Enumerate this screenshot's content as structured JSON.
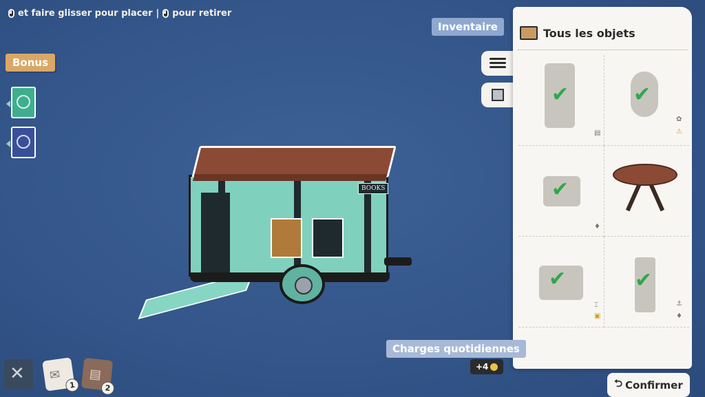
{
  "hint": {
    "place_text": "et faire glisser pour placer",
    "separator": "|",
    "remove_text": "pour retirer"
  },
  "bonus": {
    "label": "Bonus"
  },
  "wagon": {
    "sign": "BOOKS"
  },
  "inventory": {
    "tab_label": "Inventaire",
    "header": "Tous les objets"
  },
  "charges": {
    "label": "Charges quotidiennes",
    "value": "+4"
  },
  "confirm": {
    "label": "Confirmer",
    "icon": "undo-arrow-icon"
  },
  "bottom_bar": {
    "badge1": "1",
    "badge2": "2"
  },
  "colors": {
    "background": "#34568a",
    "check": "#2fa84a",
    "panel": "#f7f6f2",
    "roof": "#8b4a35",
    "wagon": "#7fd1bd"
  }
}
